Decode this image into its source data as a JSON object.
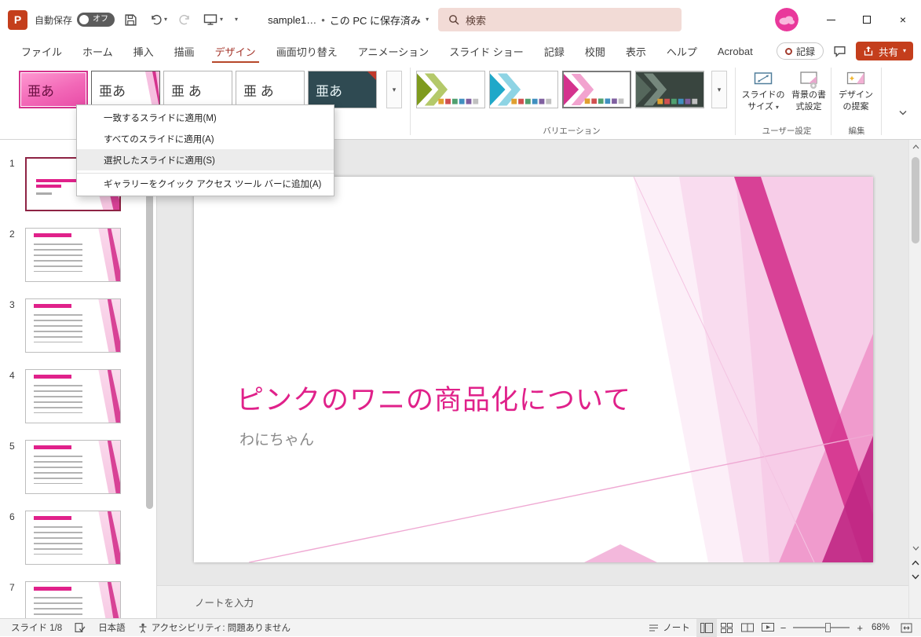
{
  "colors": {
    "brand_red": "#c43e1c",
    "accent_pink": "#d4328d",
    "title_pink": "#e0218a",
    "selected_slide_border": "#8e2344"
  },
  "titlebar": {
    "autosave_label": "自動保存",
    "autosave_state": "オフ",
    "filename": "sample1…",
    "save_status": "この PC に保存済み",
    "search_placeholder": "検索"
  },
  "ribbon_tabs": [
    {
      "label": "ファイル"
    },
    {
      "label": "ホーム"
    },
    {
      "label": "挿入"
    },
    {
      "label": "描画"
    },
    {
      "label": "デザイン",
      "selected": true
    },
    {
      "label": "画面切り替え"
    },
    {
      "label": "アニメーション"
    },
    {
      "label": "スライド ショー"
    },
    {
      "label": "記録"
    },
    {
      "label": "校閲"
    },
    {
      "label": "表示"
    },
    {
      "label": "ヘルプ"
    },
    {
      "label": "Acrobat"
    }
  ],
  "tab_actions": {
    "record": "記録",
    "share": "共有"
  },
  "themes": {
    "items": [
      {
        "cls": "theme-current",
        "label": "亜あ",
        "selected": true
      },
      {
        "cls": "theme-facet",
        "label": "亜あ"
      },
      {
        "cls": "theme-plain",
        "label": "亜 あ"
      },
      {
        "cls": "theme-plain",
        "label": "亜 あ"
      },
      {
        "cls": "theme-dark",
        "label": "亜あ"
      }
    ]
  },
  "variants": {
    "group_label": "バリエーション",
    "items": [
      {
        "cls": "v-green"
      },
      {
        "cls": "v-cyan"
      },
      {
        "cls": "v-pink",
        "selected": true
      },
      {
        "cls": "v-dark"
      }
    ]
  },
  "ribbon": {
    "slide_size_1": "スライドの",
    "slide_size_2": "サイズ",
    "format_bg_1": "背景の書",
    "format_bg_2": "式設定",
    "design_ideas_1": "デザイン",
    "design_ideas_2": "の提案",
    "group_user": "ユーザー設定",
    "group_edit": "編集"
  },
  "context_menu": {
    "items": [
      {
        "label": "一致するスライドに適用(M)"
      },
      {
        "label": "すべてのスライドに適用(A)"
      },
      {
        "label": "選択したスライドに適用(S)",
        "highlighted": true
      },
      {
        "label": "ギャラリーをクイック アクセス ツール バーに追加(A)",
        "separated": true
      }
    ]
  },
  "slides": [
    {
      "num": 1,
      "cls": "thumb-title",
      "selected": true
    },
    {
      "num": 2,
      "cls": "thumb-content"
    },
    {
      "num": 3,
      "cls": "thumb-content"
    },
    {
      "num": 4,
      "cls": "thumb-content"
    },
    {
      "num": 5,
      "cls": "thumb-content"
    },
    {
      "num": 6,
      "cls": "thumb-content"
    },
    {
      "num": 7,
      "cls": "thumb-content"
    }
  ],
  "slide": {
    "title": "ピンクのワニの商品化について",
    "subtitle": "わにちゃん"
  },
  "notes": {
    "placeholder": "ノートを入力"
  },
  "statusbar": {
    "slide_indicator": "スライド 1/8",
    "language": "日本語",
    "accessibility": "アクセシビリティ: 問題ありません",
    "notes_label": "ノート",
    "zoom_level": "68%"
  }
}
